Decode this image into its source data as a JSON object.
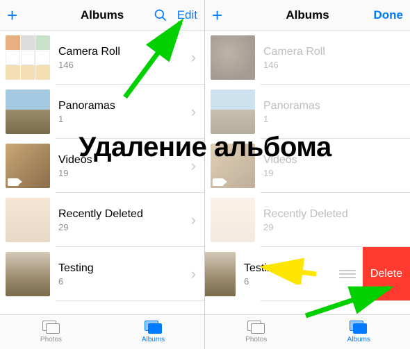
{
  "overlay_text": "Удаление альбома",
  "left": {
    "title": "Albums",
    "add": "+",
    "edit": "Edit",
    "albums": [
      {
        "name": "Camera Roll",
        "count": "146"
      },
      {
        "name": "Panoramas",
        "count": "1"
      },
      {
        "name": "Videos",
        "count": "19"
      },
      {
        "name": "Recently Deleted",
        "count": "29"
      },
      {
        "name": "Testing",
        "count": "6"
      }
    ],
    "tabs": {
      "photos": "Photos",
      "albums": "Albums"
    }
  },
  "right": {
    "title": "Albums",
    "add": "+",
    "done": "Done",
    "delete": "Delete",
    "albums": [
      {
        "name": "Camera Roll",
        "count": "146"
      },
      {
        "name": "Panoramas",
        "count": "1"
      },
      {
        "name": "Videos",
        "count": "19"
      },
      {
        "name": "Recently Deleted",
        "count": "29"
      },
      {
        "name": "Testing",
        "count": "6"
      }
    ],
    "tabs": {
      "photos": "Photos",
      "albums": "Albums"
    }
  }
}
